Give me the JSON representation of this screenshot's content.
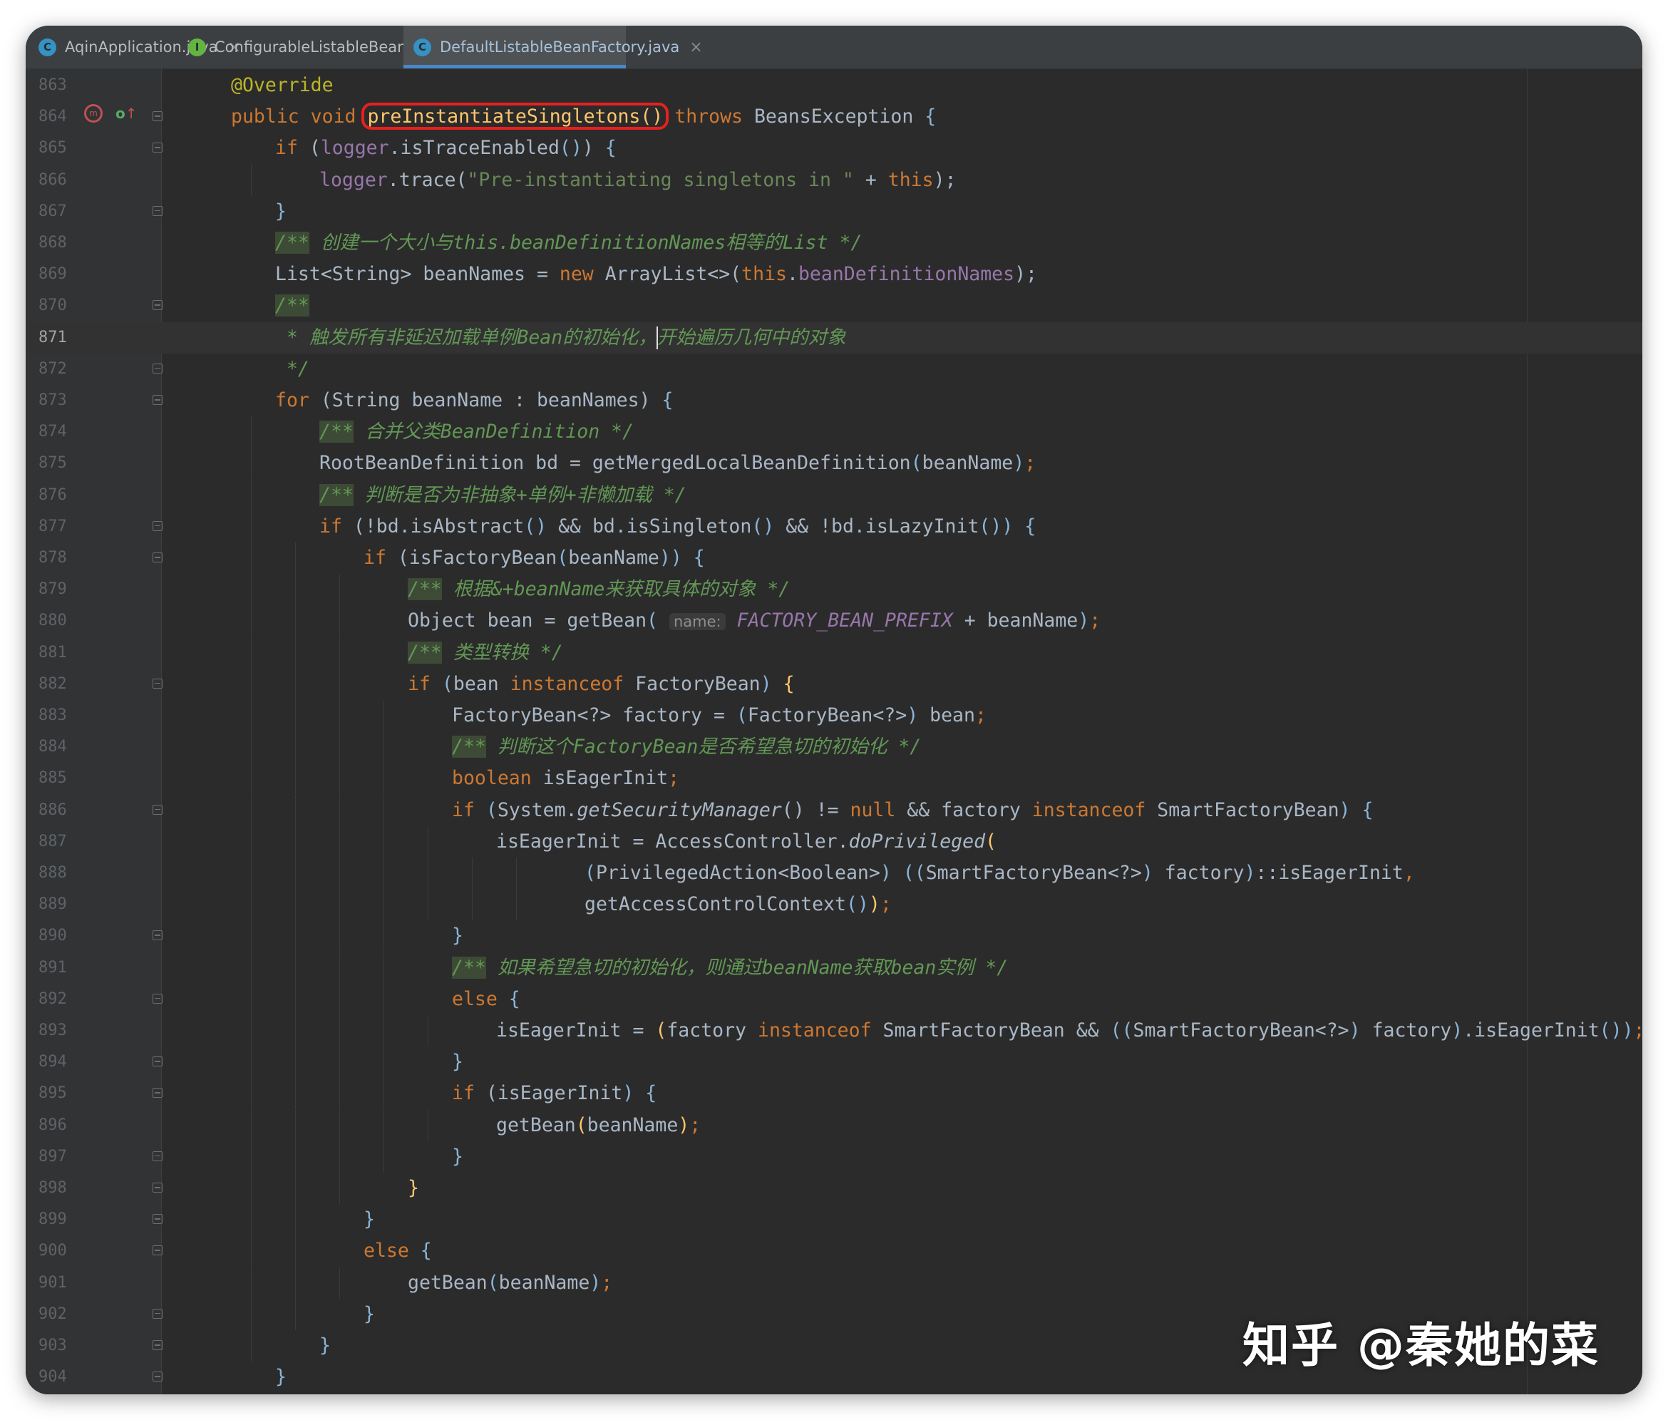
{
  "tabs": [
    {
      "label": "AqinApplication.java",
      "icon": "class-icon",
      "icon_letter": "C",
      "icon_color": "#3592c4",
      "active": false
    },
    {
      "label": "ConfigurableListableBeanFactory.java",
      "icon": "interface-icon",
      "icon_letter": "I",
      "icon_color": "#62b543",
      "active": false
    },
    {
      "label": "DefaultListableBeanFactory.java",
      "icon": "class-icon",
      "icon_letter": "C",
      "icon_color": "#3592c4",
      "active": true
    }
  ],
  "editor": {
    "current_line": 871,
    "highlighted_method": "preInstantiateSingletons()",
    "colors": {
      "background": "#2b2b2b",
      "gutter": "#313335",
      "keyword": "#cc7832",
      "comment": "#629755",
      "highlight_box": "#e82020"
    },
    "lines": [
      {
        "n": 863,
        "indent": 1,
        "fold": false,
        "tokens": [
          [
            "@Override",
            "ann"
          ]
        ]
      },
      {
        "n": 864,
        "indent": 1,
        "fold": true,
        "tokens": [
          [
            "public void ",
            "kw"
          ],
          [
            "preInstantiateSingletons()",
            "mcall"
          ],
          [
            " ",
            ""
          ],
          [
            "throws",
            "kw"
          ],
          [
            " BeansException ",
            ""
          ],
          [
            "{",
            "pr"
          ]
        ]
      },
      {
        "n": 865,
        "indent": 2,
        "fold": true,
        "tokens": [
          [
            "if",
            "kw"
          ],
          [
            " (",
            ""
          ],
          [
            "logger",
            "fld"
          ],
          [
            ".isTraceEnabled",
            ""
          ],
          [
            "()",
            "pr"
          ],
          [
            ") ",
            ""
          ],
          [
            "{",
            "pr"
          ]
        ]
      },
      {
        "n": 866,
        "indent": 3,
        "fold": false,
        "tokens": [
          [
            "logger",
            "fld"
          ],
          [
            ".trace(",
            ""
          ],
          [
            "\"Pre-instantiating singletons in \"",
            "str"
          ],
          [
            " + ",
            ""
          ],
          [
            "this",
            "kw"
          ],
          [
            ");",
            ""
          ]
        ]
      },
      {
        "n": 867,
        "indent": 2,
        "fold": true,
        "tokens": [
          [
            "}",
            "pr"
          ]
        ]
      },
      {
        "n": 868,
        "indent": 2,
        "fold": false,
        "tokens": [
          [
            "/**",
            "cmm"
          ],
          [
            " 创建一个大小与this.beanDefinitionNames相等的List */",
            "cm"
          ]
        ]
      },
      {
        "n": 869,
        "indent": 2,
        "fold": false,
        "tokens": [
          [
            "List<String> beanNames = ",
            ""
          ],
          [
            "new",
            "kw"
          ],
          [
            " ArrayList<>(",
            ""
          ],
          [
            "this",
            "kw"
          ],
          [
            ".",
            ""
          ],
          [
            "beanDefinitionNames",
            "fld"
          ],
          [
            ");",
            ""
          ]
        ]
      },
      {
        "n": 870,
        "indent": 2,
        "fold": true,
        "tokens": [
          [
            "/**",
            "cmm"
          ]
        ]
      },
      {
        "n": 871,
        "indent": 2,
        "fold": false,
        "tokens": [
          [
            " * 触发所有非延迟加载单例Bean的初始化，",
            "cm"
          ],
          [
            "开始遍历几何中的对象",
            "cm"
          ]
        ]
      },
      {
        "n": 872,
        "indent": 2,
        "fold": true,
        "tokens": [
          [
            " */",
            "cm"
          ]
        ]
      },
      {
        "n": 873,
        "indent": 2,
        "fold": true,
        "tokens": [
          [
            "for",
            "kw"
          ],
          [
            " (String beanName : beanNames) ",
            ""
          ],
          [
            "{",
            "pr"
          ]
        ]
      },
      {
        "n": 874,
        "indent": 3,
        "fold": false,
        "tokens": [
          [
            "/**",
            "cmm"
          ],
          [
            " 合并父类BeanDefinition */",
            "cm"
          ]
        ]
      },
      {
        "n": 875,
        "indent": 3,
        "fold": false,
        "tokens": [
          [
            "RootBeanDefinition bd = getMergedLocalBeanDefinition",
            ""
          ],
          [
            "(",
            "pr"
          ],
          [
            "beanName",
            ""
          ],
          [
            ")",
            "pr"
          ],
          [
            ";",
            "kw"
          ]
        ]
      },
      {
        "n": 876,
        "indent": 3,
        "fold": false,
        "tokens": [
          [
            "/**",
            "cmm"
          ],
          [
            " 判断是否为非抽象+单例+非懒加载 */",
            "cm"
          ]
        ]
      },
      {
        "n": 877,
        "indent": 3,
        "fold": true,
        "tokens": [
          [
            "if",
            "kw"
          ],
          [
            " (!bd.isAbstract",
            ""
          ],
          [
            "()",
            "pr"
          ],
          [
            " && bd.isSingleton",
            ""
          ],
          [
            "()",
            "pr"
          ],
          [
            " && !bd.isLazyInit",
            ""
          ],
          [
            "())",
            "pr"
          ],
          [
            " ",
            ""
          ],
          [
            "{",
            "pr"
          ]
        ]
      },
      {
        "n": 878,
        "indent": 4,
        "fold": true,
        "tokens": [
          [
            "if",
            "kw"
          ],
          [
            " (isFactoryBean",
            ""
          ],
          [
            "(",
            "pr"
          ],
          [
            "beanName",
            ""
          ],
          [
            "))",
            "pr"
          ],
          [
            " ",
            ""
          ],
          [
            "{",
            "pr"
          ]
        ]
      },
      {
        "n": 879,
        "indent": 5,
        "fold": false,
        "tokens": [
          [
            "/**",
            "cmm"
          ],
          [
            " 根据&+beanName来获取具体的对象 */",
            "cm"
          ]
        ]
      },
      {
        "n": 880,
        "indent": 5,
        "fold": false,
        "tokens": [
          [
            "Object bean = getBean",
            ""
          ],
          [
            "(",
            "pr"
          ],
          [
            " ",
            ""
          ],
          [
            "name:",
            "hint"
          ],
          [
            " ",
            ""
          ],
          [
            "FACTORY_BEAN_PREFIX",
            "sfld"
          ],
          [
            " + beanName",
            ""
          ],
          [
            ")",
            "pr"
          ],
          [
            ";",
            "kw"
          ]
        ]
      },
      {
        "n": 881,
        "indent": 5,
        "fold": false,
        "tokens": [
          [
            "/**",
            "cmm"
          ],
          [
            " 类型转换 */",
            "cm"
          ]
        ]
      },
      {
        "n": 882,
        "indent": 5,
        "fold": true,
        "tokens": [
          [
            "if",
            "kw"
          ],
          [
            " ",
            ""
          ],
          [
            "(",
            "pr"
          ],
          [
            "bean ",
            ""
          ],
          [
            "instanceof",
            "kw"
          ],
          [
            " FactoryBean",
            ""
          ],
          [
            ")",
            "pr"
          ],
          [
            " ",
            ""
          ],
          [
            "{",
            "mcall"
          ]
        ]
      },
      {
        "n": 883,
        "indent": 6,
        "fold": false,
        "tokens": [
          [
            "FactoryBean<?> factory = ",
            ""
          ],
          [
            "(",
            "pr"
          ],
          [
            "FactoryBean<?>",
            ""
          ],
          [
            ")",
            "pr"
          ],
          [
            " bean",
            ""
          ],
          [
            ";",
            "kw"
          ]
        ]
      },
      {
        "n": 884,
        "indent": 6,
        "fold": false,
        "tokens": [
          [
            "/**",
            "cmm"
          ],
          [
            " 判断这个FactoryBean是否希望急切的初始化 */",
            "cm"
          ]
        ]
      },
      {
        "n": 885,
        "indent": 6,
        "fold": false,
        "tokens": [
          [
            "boolean",
            "kw"
          ],
          [
            " isEagerInit",
            ""
          ],
          [
            ";",
            "kw"
          ]
        ]
      },
      {
        "n": 886,
        "indent": 6,
        "fold": true,
        "tokens": [
          [
            "if",
            "kw"
          ],
          [
            " ",
            ""
          ],
          [
            "(",
            "pr"
          ],
          [
            "System.",
            ""
          ],
          [
            "getSecurityManager",
            "stat"
          ],
          [
            "()",
            ""
          ],
          [
            " != ",
            ""
          ],
          [
            "null",
            "kw"
          ],
          [
            " && factory ",
            ""
          ],
          [
            "instanceof",
            "kw"
          ],
          [
            " SmartFactoryBean",
            ""
          ],
          [
            ")",
            "pr"
          ],
          [
            " ",
            ""
          ],
          [
            "{",
            "pr"
          ]
        ]
      },
      {
        "n": 887,
        "indent": 7,
        "fold": false,
        "tokens": [
          [
            "isEagerInit = AccessController.",
            ""
          ],
          [
            "doPrivileged",
            "stat"
          ],
          [
            "(",
            "mcall"
          ]
        ]
      },
      {
        "n": 888,
        "indent": 9,
        "fold": false,
        "tokens": [
          [
            "(",
            "pr"
          ],
          [
            "PrivilegedAction<Boolean>",
            ""
          ],
          [
            ")",
            "pr"
          ],
          [
            " ",
            ""
          ],
          [
            "((",
            "pr"
          ],
          [
            "SmartFactoryBean<?>",
            ""
          ],
          [
            ")",
            "pr"
          ],
          [
            " factory",
            ""
          ],
          [
            ")",
            "pr"
          ],
          [
            "::isEagerInit",
            ""
          ],
          [
            ",",
            "kw"
          ]
        ]
      },
      {
        "n": 889,
        "indent": 9,
        "fold": false,
        "tokens": [
          [
            "getAccessControlContext",
            ""
          ],
          [
            "()",
            "pr"
          ],
          [
            ")",
            "mcall"
          ],
          [
            ";",
            "kw"
          ]
        ]
      },
      {
        "n": 890,
        "indent": 6,
        "fold": true,
        "tokens": [
          [
            "}",
            "pr"
          ]
        ]
      },
      {
        "n": 891,
        "indent": 6,
        "fold": false,
        "tokens": [
          [
            "/**",
            "cmm"
          ],
          [
            " 如果希望急切的初始化，则通过beanName获取bean实例 */",
            "cm"
          ]
        ]
      },
      {
        "n": 892,
        "indent": 6,
        "fold": true,
        "tokens": [
          [
            "else",
            "kw"
          ],
          [
            " ",
            ""
          ],
          [
            "{",
            "pr"
          ]
        ]
      },
      {
        "n": 893,
        "indent": 7,
        "fold": false,
        "tokens": [
          [
            "isEagerInit = ",
            ""
          ],
          [
            "(",
            "mcall"
          ],
          [
            "factory ",
            ""
          ],
          [
            "instanceof",
            "kw"
          ],
          [
            " SmartFactoryBean && ",
            ""
          ],
          [
            "((",
            "pr"
          ],
          [
            "SmartFactoryBean<?>",
            ""
          ],
          [
            ")",
            "pr"
          ],
          [
            " factory",
            ""
          ],
          [
            ")",
            "pr"
          ],
          [
            ".isEagerInit",
            ""
          ],
          [
            "())",
            "pr"
          ],
          [
            ";",
            "kw"
          ]
        ]
      },
      {
        "n": 894,
        "indent": 6,
        "fold": true,
        "tokens": [
          [
            "}",
            "pr"
          ]
        ]
      },
      {
        "n": 895,
        "indent": 6,
        "fold": true,
        "tokens": [
          [
            "if",
            "kw"
          ],
          [
            " (isEagerInit",
            ""
          ],
          [
            ")",
            "pr"
          ],
          [
            " ",
            ""
          ],
          [
            "{",
            "pr"
          ]
        ]
      },
      {
        "n": 896,
        "indent": 7,
        "fold": false,
        "tokens": [
          [
            "getBean",
            ""
          ],
          [
            "(",
            "mcall"
          ],
          [
            "beanName",
            ""
          ],
          [
            ")",
            "mcall"
          ],
          [
            ";",
            "kw"
          ]
        ]
      },
      {
        "n": 897,
        "indent": 6,
        "fold": true,
        "tokens": [
          [
            "}",
            "pr"
          ]
        ]
      },
      {
        "n": 898,
        "indent": 5,
        "fold": true,
        "tokens": [
          [
            "}",
            "mcall"
          ]
        ]
      },
      {
        "n": 899,
        "indent": 4,
        "fold": true,
        "tokens": [
          [
            "}",
            "pr"
          ]
        ]
      },
      {
        "n": 900,
        "indent": 4,
        "fold": true,
        "tokens": [
          [
            "else",
            "kw"
          ],
          [
            " ",
            ""
          ],
          [
            "{",
            "pr"
          ]
        ]
      },
      {
        "n": 901,
        "indent": 5,
        "fold": false,
        "tokens": [
          [
            "getBean",
            ""
          ],
          [
            "(",
            "pr"
          ],
          [
            "beanName",
            ""
          ],
          [
            ")",
            "pr"
          ],
          [
            ";",
            "kw"
          ]
        ]
      },
      {
        "n": 902,
        "indent": 4,
        "fold": true,
        "tokens": [
          [
            "}",
            "pr"
          ]
        ]
      },
      {
        "n": 903,
        "indent": 3,
        "fold": true,
        "tokens": [
          [
            "}",
            "pr"
          ]
        ]
      },
      {
        "n": 904,
        "indent": 2,
        "fold": true,
        "tokens": [
          [
            "}",
            "pr"
          ]
        ]
      }
    ]
  },
  "watermark": "知乎 @秦她的菜"
}
